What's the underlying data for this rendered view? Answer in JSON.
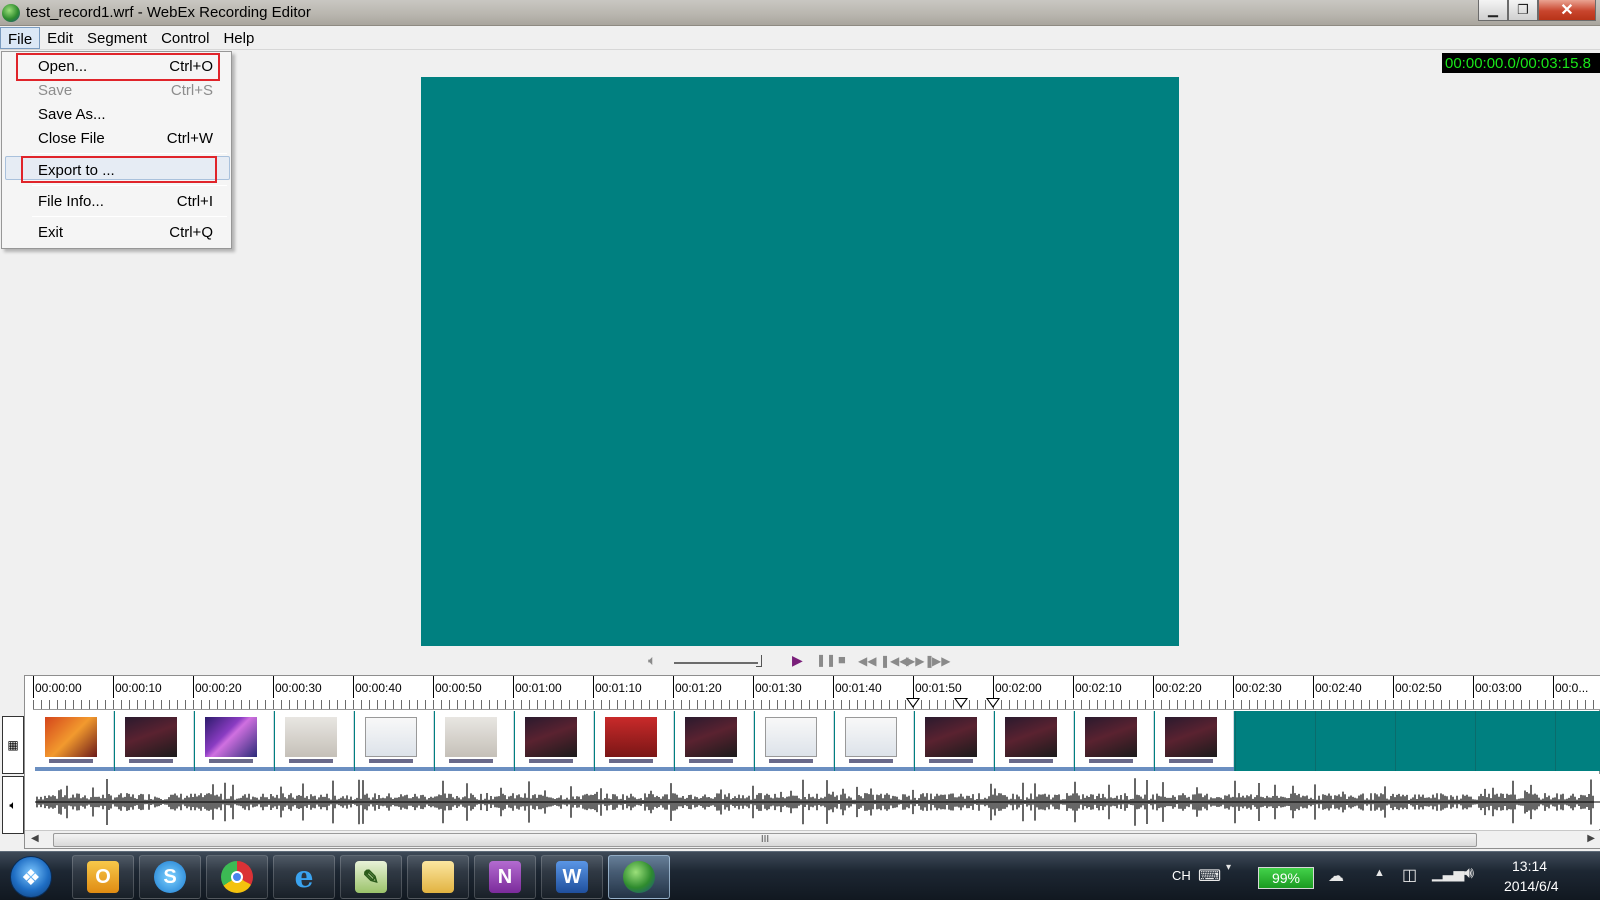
{
  "window": {
    "title": "test_record1.wrf - WebEx Recording Editor",
    "app_icon": "webex-globe-icon",
    "controls": [
      "minimize",
      "maximize",
      "close"
    ]
  },
  "menubar": {
    "items": [
      "File",
      "Edit",
      "Segment",
      "Control",
      "Help"
    ],
    "active": "File"
  },
  "file_menu": {
    "items": [
      {
        "label": "Open...",
        "shortcut": "Ctrl+O",
        "enabled": true,
        "highlighted_box": true
      },
      {
        "label": "Save",
        "shortcut": "Ctrl+S",
        "enabled": false
      },
      {
        "label": "Save As...",
        "shortcut": "",
        "enabled": true
      },
      {
        "label": "Close File",
        "shortcut": "Ctrl+W",
        "enabled": true
      },
      {
        "label": "Export to ...",
        "shortcut": "",
        "enabled": true,
        "highlighted_box": true,
        "hover": true
      },
      {
        "label": "File Info...",
        "shortcut": "Ctrl+I",
        "enabled": true
      },
      {
        "label": "Exit",
        "shortcut": "Ctrl+Q",
        "enabled": true
      }
    ]
  },
  "time_display": "00:00:00.0/00:03:15.8",
  "preview": {
    "color": "#008080"
  },
  "playback": {
    "icons": [
      "speaker-icon",
      "volume-slider",
      "play-icon",
      "pause-icon",
      "stop-icon",
      "rewind-icon",
      "skip-back-icon",
      "skip-forward-icon",
      "fast-forward-icon"
    ]
  },
  "timeline": {
    "ticks": [
      "00:00:00",
      "00:00:10",
      "00:00:20",
      "00:00:30",
      "00:00:40",
      "00:00:50",
      "00:01:00",
      "00:01:10",
      "00:01:20",
      "00:01:30",
      "00:01:40",
      "00:01:50",
      "00:02:00",
      "00:02:10",
      "00:02:20",
      "00:02:30",
      "00:02:40",
      "00:02:50",
      "00:03:00",
      "00:0..."
    ],
    "markers_at": [
      "00:01:50",
      "00:01:56",
      "00:02:00"
    ],
    "video_frames": 15,
    "scroll_thumb_label": "III"
  },
  "taskbar": {
    "apps": [
      "outlook-icon",
      "skype-icon",
      "chrome-icon",
      "ie-icon",
      "notepad-icon",
      "folder-icon",
      "onenote-icon",
      "word-icon",
      "webex-recorder-icon"
    ],
    "language": "CH",
    "battery": "99%",
    "time": "13:14",
    "date": "2014/6/4"
  }
}
